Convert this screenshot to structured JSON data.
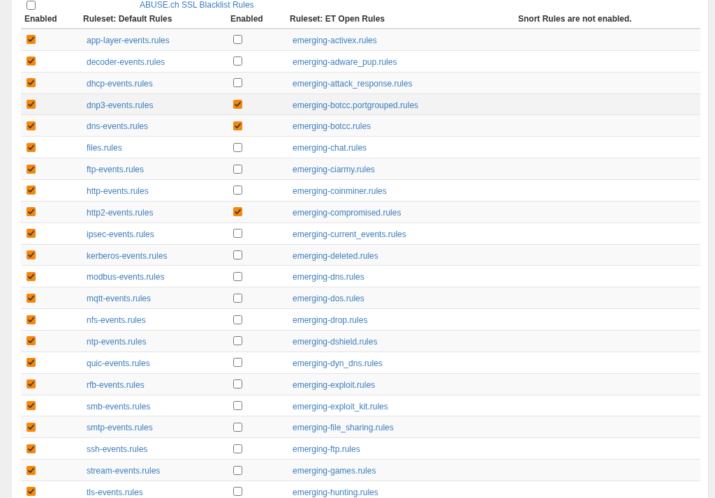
{
  "above_row": {
    "enabled": false,
    "label": "ABUSE.ch SSL Blacklist Rules"
  },
  "columns": [
    "Enabled",
    "Ruleset: Default Rules",
    "Enabled",
    "Ruleset: ET Open Rules",
    "Snort Rules are not enabled."
  ],
  "rows": [
    {
      "default_enabled": true,
      "default_rule": "app-layer-events.rules",
      "et_enabled": false,
      "et_rule": "emerging-activex.rules",
      "hovered": false
    },
    {
      "default_enabled": true,
      "default_rule": "decoder-events.rules",
      "et_enabled": false,
      "et_rule": "emerging-adware_pup.rules",
      "hovered": false
    },
    {
      "default_enabled": true,
      "default_rule": "dhcp-events.rules",
      "et_enabled": false,
      "et_rule": "emerging-attack_response.rules",
      "hovered": false
    },
    {
      "default_enabled": true,
      "default_rule": "dnp3-events.rules",
      "et_enabled": true,
      "et_rule": "emerging-botcc.portgrouped.rules",
      "hovered": true
    },
    {
      "default_enabled": true,
      "default_rule": "dns-events.rules",
      "et_enabled": true,
      "et_rule": "emerging-botcc.rules",
      "hovered": false
    },
    {
      "default_enabled": true,
      "default_rule": "files.rules",
      "et_enabled": false,
      "et_rule": "emerging-chat.rules",
      "hovered": false
    },
    {
      "default_enabled": true,
      "default_rule": "ftp-events.rules",
      "et_enabled": false,
      "et_rule": "emerging-ciarmy.rules",
      "hovered": false
    },
    {
      "default_enabled": true,
      "default_rule": "http-events.rules",
      "et_enabled": false,
      "et_rule": "emerging-coinminer.rules",
      "hovered": false
    },
    {
      "default_enabled": true,
      "default_rule": "http2-events.rules",
      "et_enabled": true,
      "et_rule": "emerging-compromised.rules",
      "hovered": false
    },
    {
      "default_enabled": true,
      "default_rule": "ipsec-events.rules",
      "et_enabled": false,
      "et_rule": "emerging-current_events.rules",
      "hovered": false
    },
    {
      "default_enabled": true,
      "default_rule": "kerberos-events.rules",
      "et_enabled": false,
      "et_rule": "emerging-deleted.rules",
      "hovered": false
    },
    {
      "default_enabled": true,
      "default_rule": "modbus-events.rules",
      "et_enabled": false,
      "et_rule": "emerging-dns.rules",
      "hovered": false
    },
    {
      "default_enabled": true,
      "default_rule": "mqtt-events.rules",
      "et_enabled": false,
      "et_rule": "emerging-dos.rules",
      "hovered": false
    },
    {
      "default_enabled": true,
      "default_rule": "nfs-events.rules",
      "et_enabled": false,
      "et_rule": "emerging-drop.rules",
      "hovered": false
    },
    {
      "default_enabled": true,
      "default_rule": "ntp-events.rules",
      "et_enabled": false,
      "et_rule": "emerging-dshield.rules",
      "hovered": false
    },
    {
      "default_enabled": true,
      "default_rule": "quic-events.rules",
      "et_enabled": false,
      "et_rule": "emerging-dyn_dns.rules",
      "hovered": false
    },
    {
      "default_enabled": true,
      "default_rule": "rfb-events.rules",
      "et_enabled": false,
      "et_rule": "emerging-exploit.rules",
      "hovered": false
    },
    {
      "default_enabled": true,
      "default_rule": "smb-events.rules",
      "et_enabled": false,
      "et_rule": "emerging-exploit_kit.rules",
      "hovered": false
    },
    {
      "default_enabled": true,
      "default_rule": "smtp-events.rules",
      "et_enabled": false,
      "et_rule": "emerging-file_sharing.rules",
      "hovered": false
    },
    {
      "default_enabled": true,
      "default_rule": "ssh-events.rules",
      "et_enabled": false,
      "et_rule": "emerging-ftp.rules",
      "hovered": false
    },
    {
      "default_enabled": true,
      "default_rule": "stream-events.rules",
      "et_enabled": false,
      "et_rule": "emerging-games.rules",
      "hovered": false
    },
    {
      "default_enabled": true,
      "default_rule": "tls-events.rules",
      "et_enabled": false,
      "et_rule": "emerging-hunting.rules",
      "hovered": false
    }
  ]
}
